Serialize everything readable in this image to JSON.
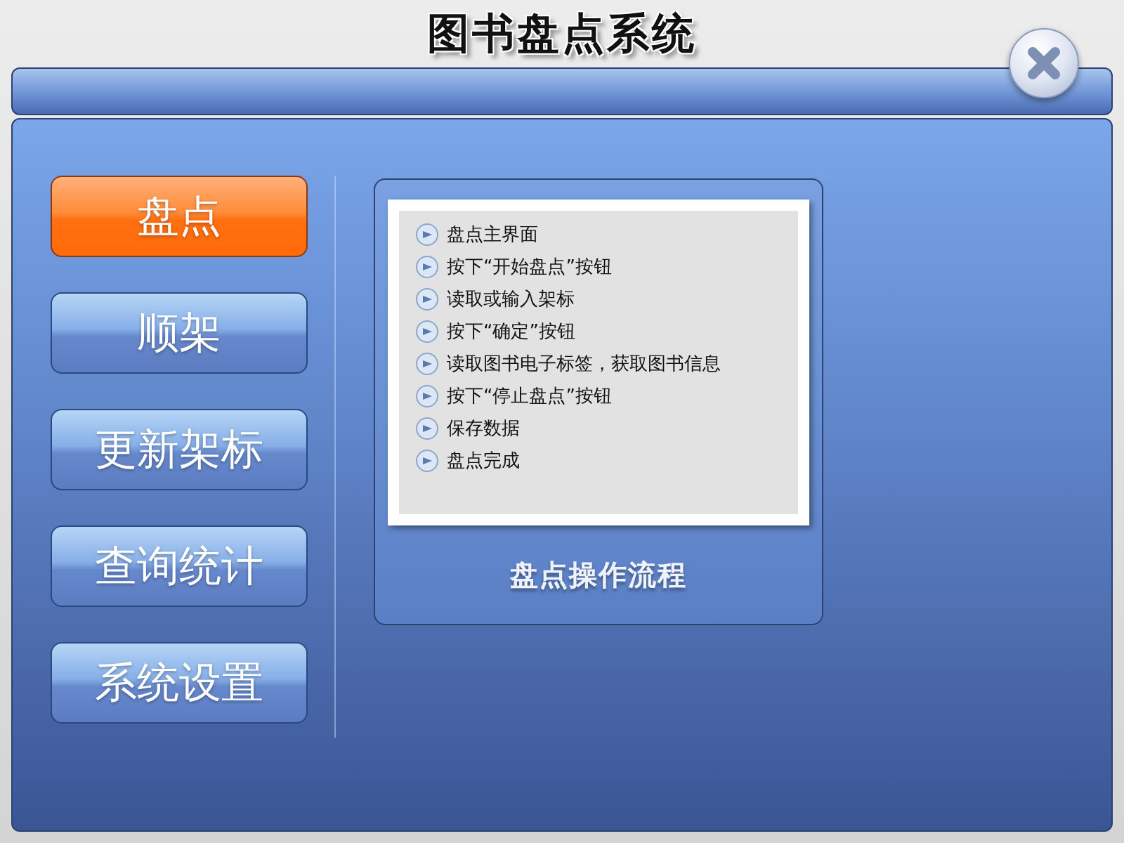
{
  "window": {
    "title": "图书盘点系统"
  },
  "nav": [
    {
      "label": "盘点",
      "selected": true
    },
    {
      "label": "顺架",
      "selected": false
    },
    {
      "label": "更新架标",
      "selected": false
    },
    {
      "label": "查询统计",
      "selected": false
    },
    {
      "label": "系统设置",
      "selected": false
    }
  ],
  "flow_card": {
    "steps": [
      "盘点主界面",
      "按下“开始盘点”按钮",
      "读取或输入架标",
      "按下“确定”按钮",
      "读取图书电子标签，获取图书信息",
      "按下“停止盘点”按钮",
      "保存数据",
      "盘点完成"
    ],
    "caption": "盘点操作流程"
  }
}
